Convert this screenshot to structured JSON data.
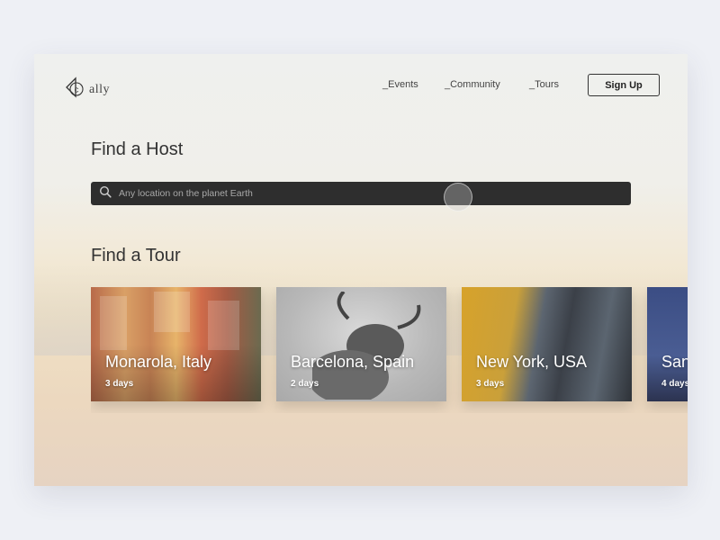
{
  "app": {
    "logo_text": "ally",
    "logo_letter": "c"
  },
  "nav": {
    "events": "_Events",
    "community": "_Community",
    "tours": "_Tours",
    "signup": "Sign Up"
  },
  "host": {
    "heading": "Find a Host",
    "search_placeholder": "Any location on the planet Earth"
  },
  "tour": {
    "heading": "Find a Tour",
    "cards": [
      {
        "name": "Monarola, Italy",
        "duration": "3 days"
      },
      {
        "name": "Barcelona, Spain",
        "duration": "2 days"
      },
      {
        "name": "New York, USA",
        "duration": "3 days"
      },
      {
        "name": "San",
        "duration": "4 days"
      }
    ]
  },
  "colors": {
    "search_bg": "#2e2e2e",
    "text_dark": "#333333",
    "page_bg": "#eef0f5"
  },
  "icons": {
    "logo": "cally-logo-icon",
    "search": "search-icon"
  }
}
